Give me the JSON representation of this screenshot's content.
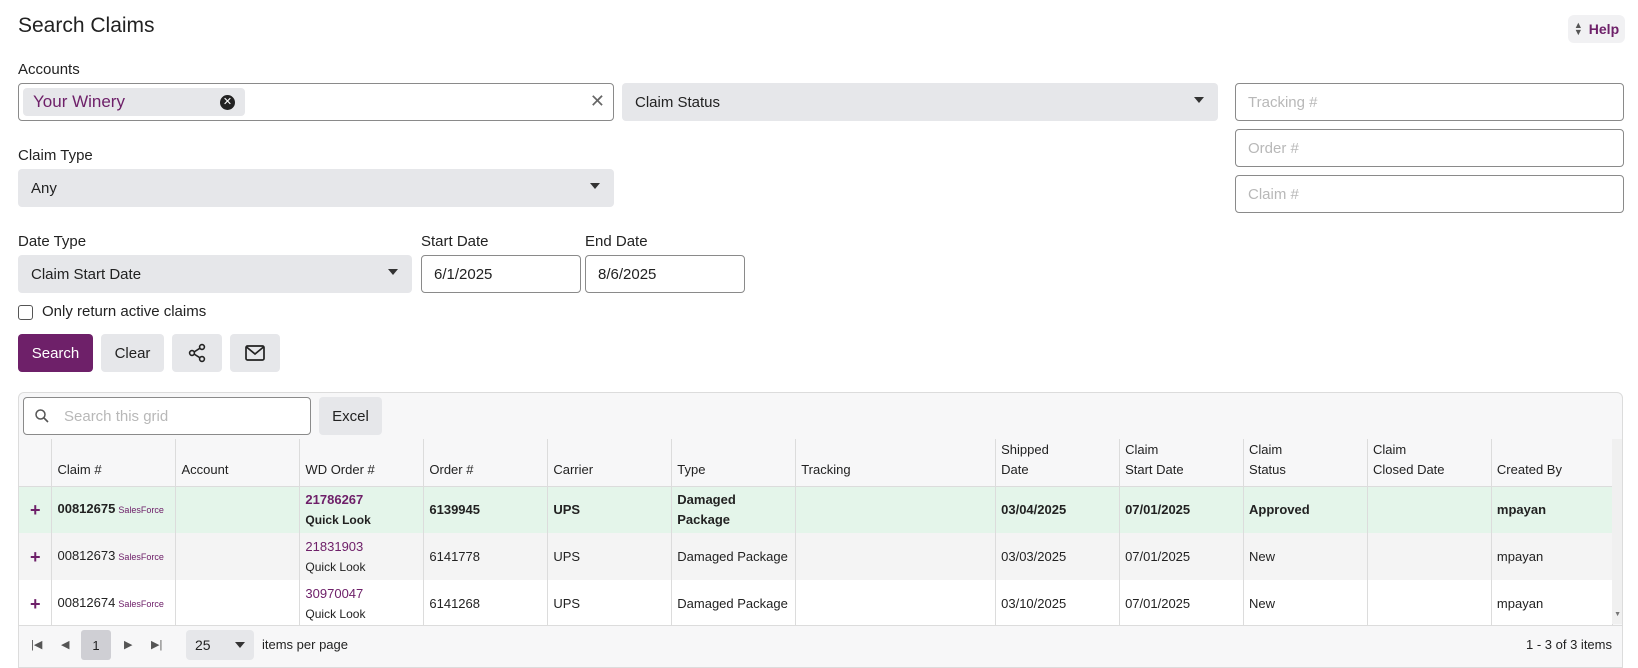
{
  "page": {
    "title": "Search Claims",
    "help_label": "Help"
  },
  "filters": {
    "accounts_label": "Accounts",
    "accounts_chip": "Your Winery",
    "claim_status_placeholder": "Claim Status",
    "tracking_placeholder": "Tracking #",
    "order_placeholder": "Order #",
    "claim_placeholder": "Claim #",
    "claim_type_label": "Claim Type",
    "claim_type_value": "Any",
    "date_type_label": "Date Type",
    "date_type_value": "Claim Start Date",
    "start_date_label": "Start Date",
    "start_date_value": "6/1/2025",
    "end_date_label": "End Date",
    "end_date_value": "8/6/2025",
    "active_only_label": "Only return active claims",
    "active_only_checked": false
  },
  "actions": {
    "search_label": "Search",
    "clear_label": "Clear",
    "share_icon": "share-icon",
    "email_icon": "mail-icon"
  },
  "grid": {
    "search_placeholder": "Search this grid",
    "excel_label": "Excel",
    "columns": {
      "claim": "Claim #",
      "account": "Account",
      "wd_order": "WD Order #",
      "order": "Order #",
      "carrier": "Carrier",
      "type": "Type",
      "tracking": "Tracking",
      "shipped_1": "Shipped",
      "shipped_2": "Date",
      "start_1": "Claim",
      "start_2": "Start Date",
      "status_1": "Claim",
      "status_2": "Status",
      "closed_1": "Claim",
      "closed_2": "Closed Date",
      "created_by": "Created By"
    },
    "rows": [
      {
        "expand": "+",
        "claim": "00812675",
        "source": "SalesForce",
        "account": "",
        "wd_order": "21786267",
        "quick_look": "Quick Look",
        "order": "6139945",
        "carrier": "UPS",
        "type": "Damaged Package",
        "tracking": "",
        "shipped": "03/04/2025",
        "start": "07/01/2025",
        "status": "Approved",
        "closed": "",
        "created_by": "mpayan"
      },
      {
        "expand": "+",
        "claim": "00812673",
        "source": "SalesForce",
        "account": "",
        "wd_order": "21831903",
        "quick_look": "Quick Look",
        "order": "6141778",
        "carrier": "UPS",
        "type": "Damaged Package",
        "tracking": "",
        "shipped": "03/03/2025",
        "start": "07/01/2025",
        "status": "New",
        "closed": "",
        "created_by": "mpayan"
      },
      {
        "expand": "+",
        "claim": "00812674",
        "source": "SalesForce",
        "account": "",
        "wd_order": "30970047",
        "quick_look": "Quick Look",
        "order": "6141268",
        "carrier": "UPS",
        "type": "Damaged Package",
        "tracking": "",
        "shipped": "03/10/2025",
        "start": "07/01/2025",
        "status": "New",
        "closed": "",
        "created_by": "mpayan"
      }
    ],
    "pager": {
      "current_page": "1",
      "page_size": "25",
      "per_page_label": "items per page",
      "info": "1 - 3 of 3 items"
    }
  },
  "colors": {
    "accent": "#6e2069",
    "highlight_row": "#e4f5ea"
  }
}
